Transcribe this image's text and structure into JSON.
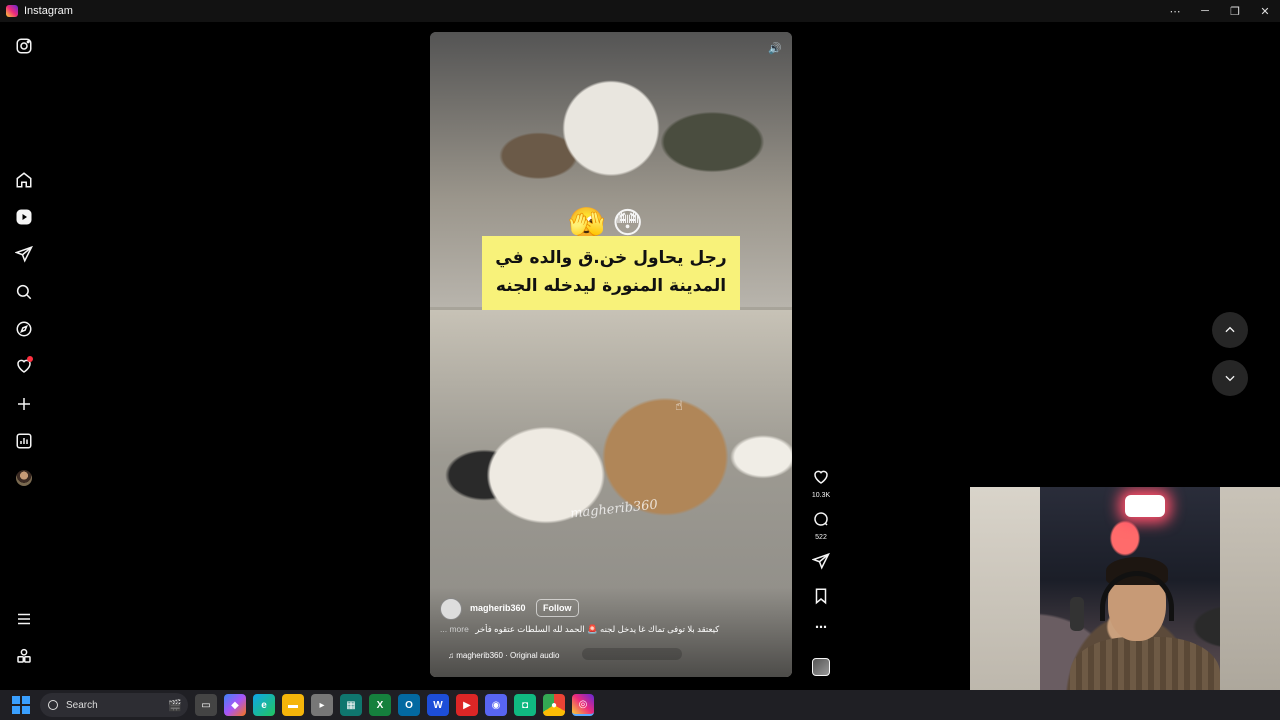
{
  "window": {
    "title": "Instagram"
  },
  "sidebar": {
    "items": [
      {
        "name": "instagram-logo-icon"
      },
      {
        "name": "home-icon"
      },
      {
        "name": "reels-icon"
      },
      {
        "name": "messages-icon"
      },
      {
        "name": "search-icon"
      },
      {
        "name": "explore-icon"
      },
      {
        "name": "notifications-icon"
      },
      {
        "name": "create-icon"
      },
      {
        "name": "dashboard-icon"
      },
      {
        "name": "profile-icon"
      },
      {
        "name": "menu-icon"
      },
      {
        "name": "threads-icon"
      }
    ]
  },
  "reel": {
    "overlay_text": "رجل يحاول خن.ق والده في المدينة المنورة ليدخله الجنه",
    "watermark": "magherib360",
    "author": {
      "username": "magherib360",
      "follow_label": "Follow"
    },
    "caption": "كيعتقد بلا توفى تماك غا يدخل لجنه 🚨 الحمد لله السلطات عتقوه فأخر",
    "more_label": "... more",
    "audio": "magherib360 · Original audio",
    "likes": "10.3K",
    "comments": "522"
  },
  "taskbar": {
    "search_placeholder": "Search"
  },
  "colors": {
    "caption_bg": "#f8f27a",
    "notification_dot": "#ff3040",
    "accent": "#3aa0ff"
  }
}
